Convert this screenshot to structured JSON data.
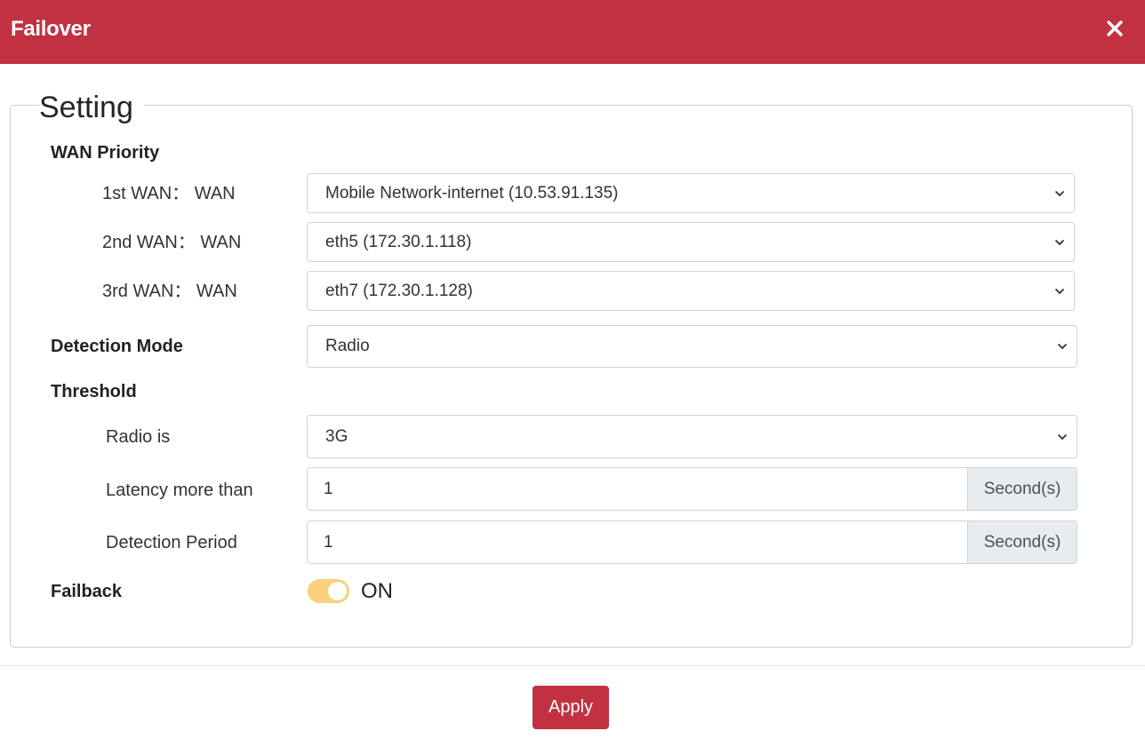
{
  "window": {
    "title": "Failover"
  },
  "setting": {
    "legend": "Setting",
    "wan_priority": {
      "label": "WAN Priority",
      "rows": [
        {
          "label": "1st WAN： WAN",
          "value": "Mobile Network-internet (10.53.91.135)"
        },
        {
          "label": "2nd WAN： WAN",
          "value": "eth5 (172.30.1.118)"
        },
        {
          "label": "3rd WAN： WAN",
          "value": "eth7 (172.30.1.128)"
        }
      ]
    },
    "detection_mode": {
      "label": "Detection Mode",
      "value": "Radio"
    },
    "threshold": {
      "label": "Threshold",
      "radio": {
        "label": "Radio is",
        "value": "3G"
      },
      "latency": {
        "label": "Latency more than",
        "value": "1",
        "unit": "Second(s)"
      },
      "period": {
        "label": "Detection Period",
        "value": "1",
        "unit": "Second(s)"
      }
    },
    "failback": {
      "label": "Failback",
      "state": "ON"
    }
  },
  "footer": {
    "apply_label": "Apply"
  },
  "colors": {
    "accent": "#c13142",
    "toggle_on": "#f7d27a",
    "addon_bg": "#e9ecef"
  },
  "icons": {
    "close": "close-icon",
    "select": "chevron-down-icon"
  }
}
